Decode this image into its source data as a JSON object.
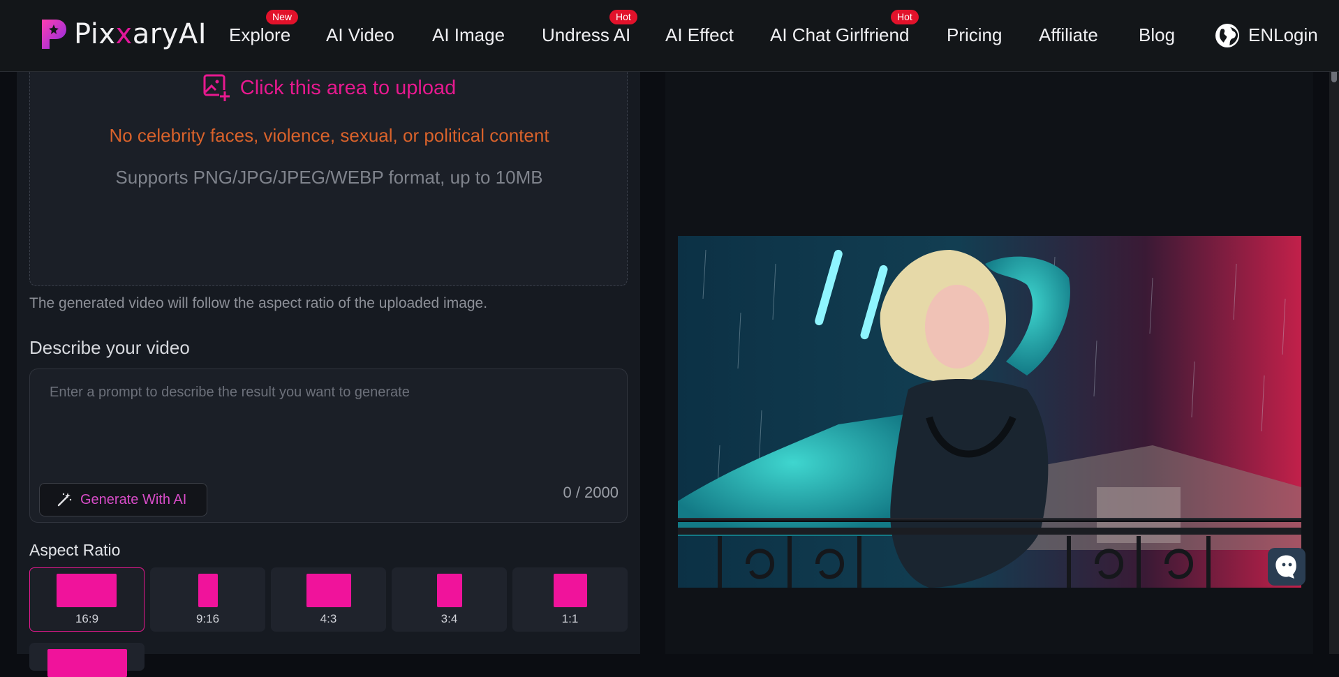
{
  "brand": {
    "name_prefix": "Pix",
    "name_x": "x",
    "name_suffix": "aryAI"
  },
  "nav": {
    "explore": "Explore",
    "explore_badge": "New",
    "ai_video": "AI Video",
    "ai_image": "AI Image",
    "undress_ai": "Undress AI",
    "undress_badge": "Hot",
    "ai_effect": "AI Effect",
    "ai_chat_girlfriend": "AI Chat Girlfriend",
    "girlfriend_badge": "Hot",
    "pricing": "Pricing",
    "affiliate": "Affiliate",
    "blog": "Blog",
    "language": "EN",
    "login": "Login"
  },
  "upload": {
    "cta": "Click this area to upload",
    "warning": "No celebrity faces, violence, sexual, or political content",
    "formats": "Supports PNG/JPG/JPEG/WEBP format, up to 10MB"
  },
  "aspect_note": "The generated video will follow the aspect ratio of the uploaded image.",
  "prompt": {
    "label": "Describe your video",
    "placeholder": "Enter a prompt to describe the result you want to generate",
    "value": "",
    "generate_label": "Generate With AI",
    "counter": "0 / 2000"
  },
  "aspect_ratio": {
    "label": "Aspect Ratio",
    "options": [
      "16:9",
      "9:16",
      "4:3",
      "3:4",
      "1:1"
    ],
    "selected": "16:9"
  },
  "colors": {
    "accent": "#e7198f",
    "warning": "#d9622b",
    "badge": "#e2122b",
    "panel": "#161a21"
  },
  "icons": {
    "upload": "image-upload-icon",
    "wand": "magic-wand-icon",
    "globe": "globe-icon",
    "help": "chat-support-icon"
  }
}
